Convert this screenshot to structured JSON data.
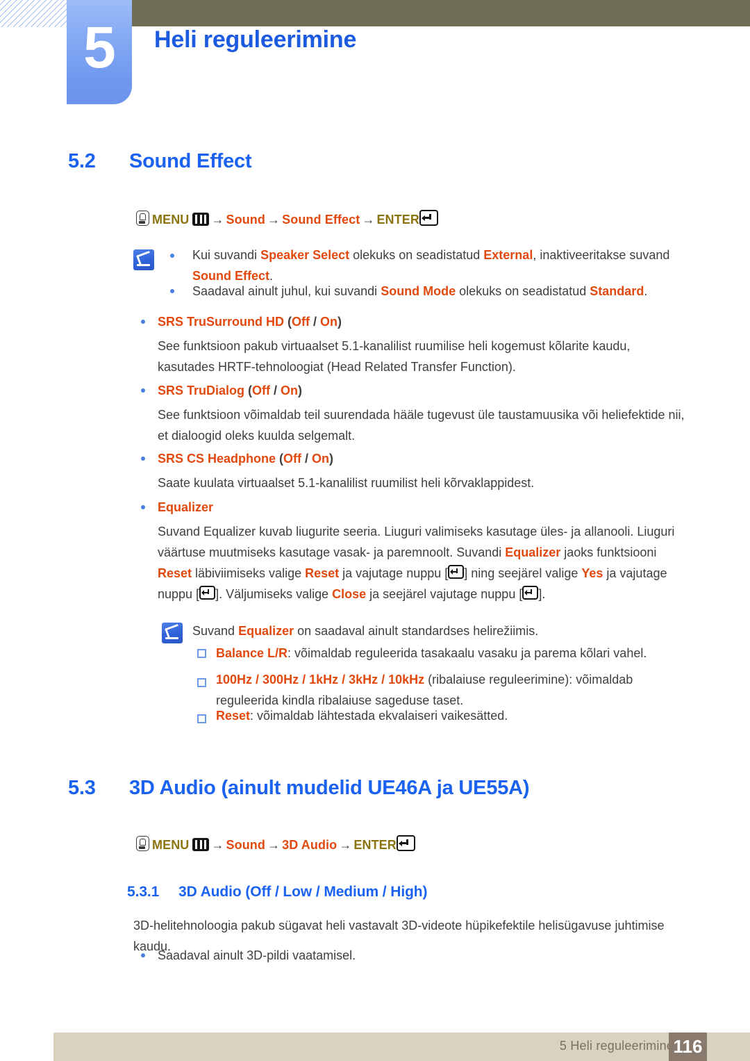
{
  "header": {
    "chapter_number": "5",
    "chapter_title": "Heli reguleerimine"
  },
  "sections": {
    "s52": {
      "number": "5.2",
      "title": "Sound Effect",
      "menu_path": {
        "menu_label": "MENU",
        "arrow": "→",
        "step1": "Sound",
        "step2": "Sound Effect",
        "enter_label": "ENTER"
      },
      "notes": [
        {
          "text_parts": [
            {
              "t": "Kui suvandi ",
              "s": "plain"
            },
            {
              "t": "Speaker Select",
              "s": "bold-orange"
            },
            {
              "t": " olekuks on seadistatud ",
              "s": "plain"
            },
            {
              "t": "External",
              "s": "bold-orange"
            },
            {
              "t": ", inaktiveeritakse suvand ",
              "s": "plain"
            },
            {
              "t": "Sound Effect",
              "s": "bold-orange"
            },
            {
              "t": ".",
              "s": "plain"
            }
          ],
          "plain": "Kui suvandi Speaker Select olekuks on seadistatud External, inaktiveeritakse suvand Sound Effect."
        },
        {
          "plain": "Saadaval ainult juhul, kui suvandi Sound Mode olekuks on seadistatud Standard."
        }
      ],
      "items": [
        {
          "title": "SRS TruSurround HD",
          "options": "(Off / On)",
          "body": "See funktsioon pakub virtuaalset 5.1-kanalilist ruumilise heli kogemust kõlarite kaudu, kasutades HRTF-tehnoloogiat (Head Related Transfer Function)."
        },
        {
          "title": "SRS TruDialog",
          "options": "(Off / On)",
          "body": "See funktsioon võimaldab teil suurendada hääle tugevust üle taustamuusika või heliefektide nii, et dialoogid oleks kuulda selgemalt."
        },
        {
          "title": "SRS CS Headphone",
          "options": "(Off / On)",
          "body": "Saate kuulata virtuaalset 5.1-kanalilist ruumilist heli kõrvaklappidest."
        },
        {
          "title": "Equalizer",
          "options": "",
          "body": "Suvand Equalizer kuvab liugurite seeria. Liuguri valimiseks kasutage üles- ja allanooli. Liuguri väärtuse muutmiseks kasutage vasak- ja paremnoolt. Suvandi Equalizer jaoks funktsiooni Reset läbiviimiseks valige Reset ja vajutage nuppu [ ] ning seejärel valige Yes ja vajutage nuppu [ ]. Väljumiseks valige Close ja seejärel vajutage nuppu [ ]."
        }
      ],
      "equalizer_note": {
        "intro": "Suvand Equalizer on saadaval ainult standardses helirežiimis.",
        "subitems": [
          {
            "term": "Balance L/R",
            "desc": ": võimaldab reguleerida tasakaalu vasaku ja parema kõlari vahel."
          },
          {
            "term": "100Hz / 300Hz / 1kHz / 3kHz / 10kHz",
            "desc": " (ribalaiuse reguleerimine): võimaldab reguleerida kindla ribalaiuse sageduse taset."
          },
          {
            "term": "Reset",
            "desc": ": võimaldab lähtestada ekvalaiseri vaikesätted."
          }
        ]
      }
    },
    "s53": {
      "number": "5.3",
      "title": "3D Audio (ainult mudelid UE46A ja UE55A)",
      "menu_path": {
        "menu_label": "MENU",
        "arrow": "→",
        "step1": "Sound",
        "step2": "3D Audio",
        "enter_label": "ENTER"
      },
      "subsection": {
        "number": "5.3.1",
        "title": "3D Audio (Off / Low / Medium / High)",
        "body": "3D-helitehnoloogia pakub sügavat heli vastavalt 3D-videote hüpikefektile helisügavuse juhtimise kaudu.",
        "bullet": "Saadaval ainult 3D-pildi vaatamisel."
      }
    }
  },
  "footer": {
    "label": "5 Heli reguleerimine",
    "page": "116"
  },
  "colors": {
    "heading_blue": "#1a62ef",
    "accent_orange": "#e2490e",
    "menu_olive": "#8b7410",
    "header_olive": "#6f6d55",
    "tab_blue": "#85aaf3",
    "footer_bar": "#d8d2be",
    "page_box": "#8a7a6d"
  }
}
